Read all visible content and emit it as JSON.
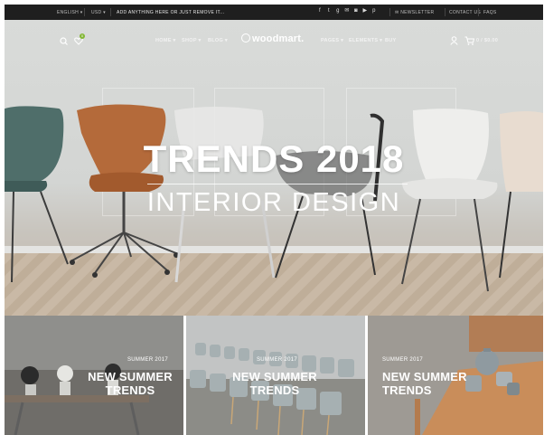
{
  "topbar": {
    "language": "ENGLISH",
    "currency": "USD",
    "announcement": "ADD ANYTHING HERE OR JUST REMOVE IT...",
    "newsletter": "NEWSLETTER",
    "contact": "CONTACT US",
    "faqs": "FAQS"
  },
  "header": {
    "logo": "woodmart.",
    "nav_left": [
      "HOME",
      "SHOP",
      "BLOG"
    ],
    "nav_right": [
      "PAGES",
      "ELEMENTS",
      "BUY"
    ],
    "cart_count": "0",
    "cart_total": "$0.00",
    "wishlist_count": "0"
  },
  "hero": {
    "title": "TRENDS 2018",
    "subtitle": "INTERIOR DESIGN"
  },
  "promos": [
    {
      "kicker": "SUMMER 2017",
      "title_line1": "NEW SUMMER",
      "title_line2": "TRENDS"
    },
    {
      "kicker": "SUMMER 2017",
      "title_line1": "NEW SUMMER",
      "title_line2": "TRENDS"
    },
    {
      "kicker": "SUMMER 2017",
      "title_line1": "NEW SUMMER",
      "title_line2": "TRENDS"
    }
  ],
  "colors": {
    "topbar_bg": "#1f1f1f",
    "accent_green": "#83b735"
  }
}
